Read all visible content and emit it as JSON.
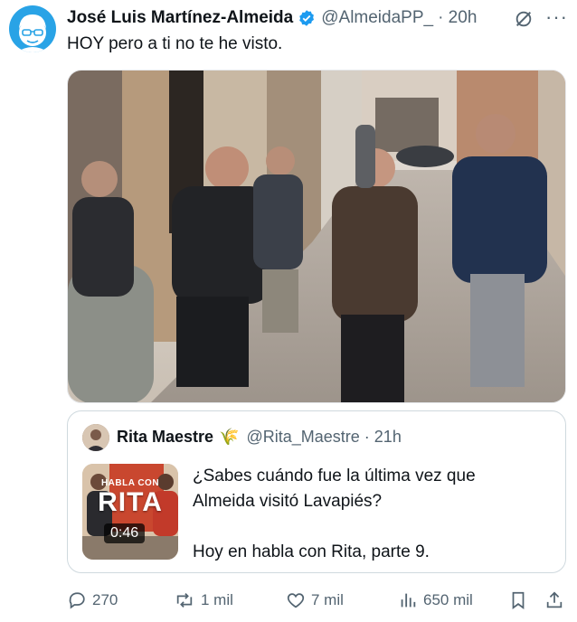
{
  "tweet": {
    "author_name": "José Luis Martínez-Almeida",
    "handle": "@AlmeidaPP_",
    "time": "· 20h",
    "text": "HOY pero a ti no te he visto."
  },
  "quote": {
    "author_name": "Rita Maestre",
    "emoji": "🌾",
    "handle": "@Rita_Maestre",
    "time": "· 21h",
    "text_line1": "¿Sabes cuándo fue la última vez que",
    "text_line2": "Almeida visitó Lavapiés?",
    "text_line3": "Hoy en habla con Rita, parte 9.",
    "thumb_label_top": "HABLA CON",
    "thumb_label_main": "RITA",
    "video_duration": "0:46"
  },
  "actions": {
    "replies": "270",
    "reposts": "1 mil",
    "likes": "7 mil",
    "views": "650 mil"
  },
  "colors": {
    "verified": "#1d9bf0",
    "avatar_bg": "#29a3e6",
    "secondary_text": "#536471"
  },
  "icons": [
    "avatar-caricature",
    "verified-badge-icon",
    "grok-icon",
    "more-icon",
    "reply-icon",
    "repost-icon",
    "like-icon",
    "views-icon",
    "bookmark-icon",
    "share-icon",
    "wheat-emoji"
  ]
}
